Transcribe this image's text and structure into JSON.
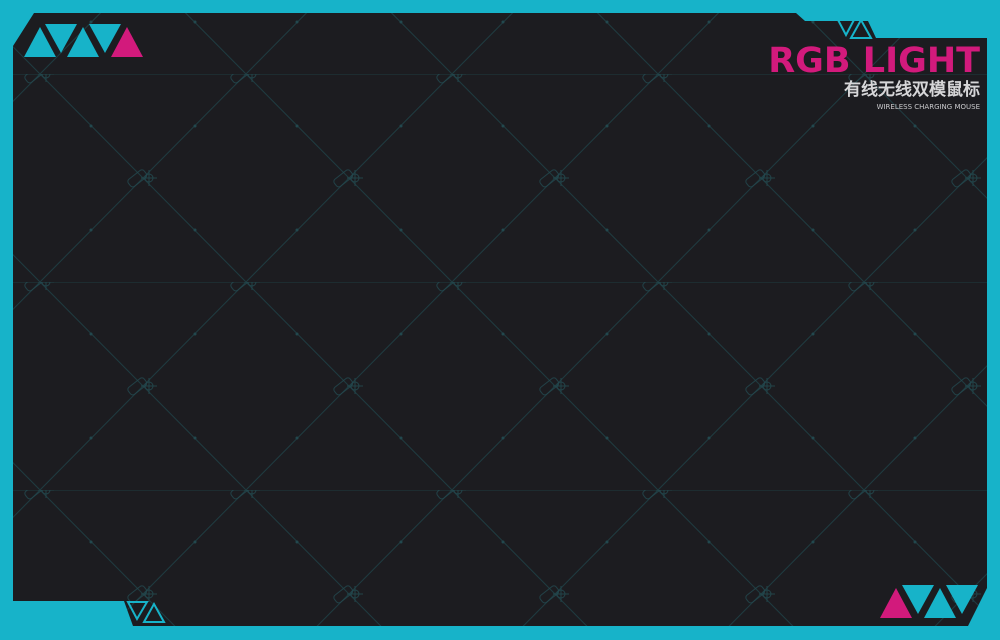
{
  "product": {
    "title": "RGB LIGHT",
    "subtitle_cn": "有线无线双模鼠标",
    "subtitle_en": "WIRELESS CHARGING MOUSE"
  },
  "colors": {
    "frame": "#17b3c9",
    "panel": "#1c1c20",
    "accent": "#d21a7c",
    "pattern": "#1d4248"
  },
  "icons": [
    "triangle-icon",
    "pattern-mouse-icon",
    "crosshair-icon"
  ]
}
